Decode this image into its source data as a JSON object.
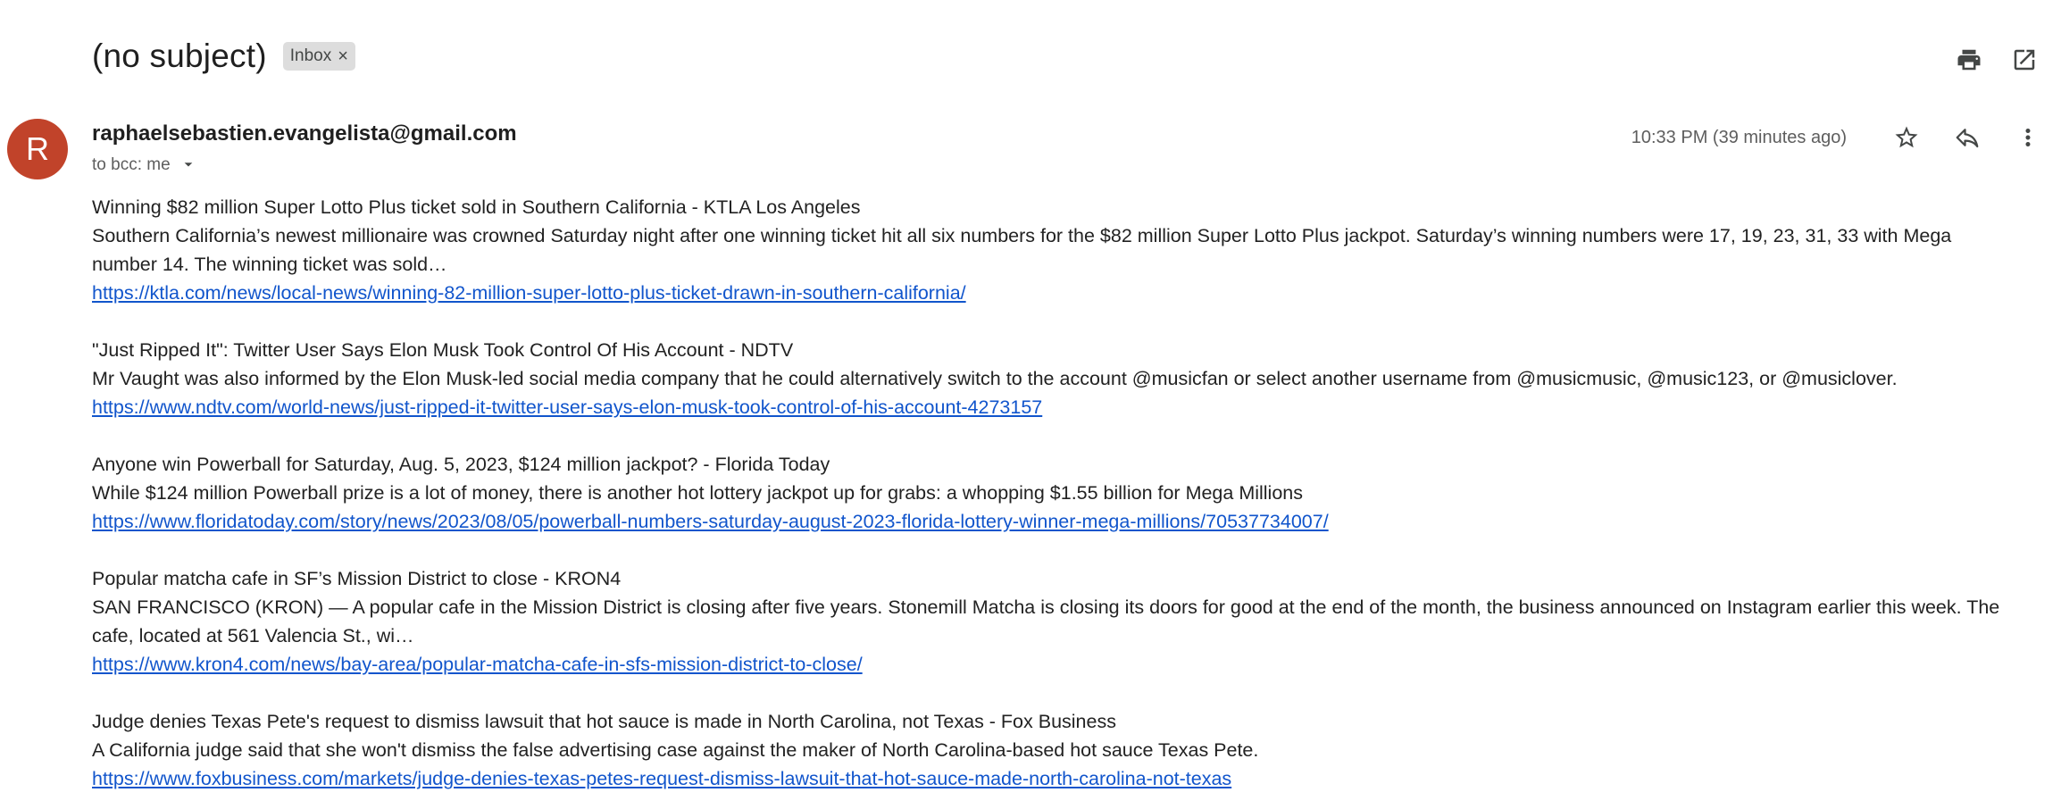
{
  "header": {
    "subject": "(no subject)",
    "label": "Inbox",
    "label_remove": "×"
  },
  "sender": {
    "avatar_letter": "R",
    "email": "raphaelsebastien.evangelista@gmail.com",
    "recipients": "to bcc: me",
    "timestamp": "10:33 PM (39 minutes ago)"
  },
  "colors": {
    "avatar": "#c1432a",
    "link": "#1155cc",
    "chip": "#dddddd"
  },
  "icons": {
    "print": "print-icon",
    "open_new_window": "open-in-new-window-icon",
    "star": "star-icon",
    "reply": "reply-icon",
    "more": "more-vert-icon",
    "dropdown": "dropdown-arrow-icon"
  },
  "items": [
    {
      "title": "Winning $82 million Super Lotto Plus ticket sold in Southern California - KTLA Los Angeles",
      "snippet": "Southern California’s newest millionaire was crowned Saturday night after one winning ticket hit all six numbers for the $82 million Super Lotto Plus jackpot. Saturday’s winning numbers were 17, 19, 23, 31, 33 with Mega number 14.  The winning ticket was sold…",
      "url": "https://ktla.com/news/local-news/winning-82-million-super-lotto-plus-ticket-drawn-in-southern-california/"
    },
    {
      "title": "\"Just Ripped It\": Twitter User Says Elon Musk Took Control Of His Account - NDTV",
      "snippet": "Mr Vaught was also informed by the Elon Musk-led social media company that he could alternatively switch to the account @musicfan or select another username from @musicmusic, @music123, or @musiclover.",
      "url": "https://www.ndtv.com/world-news/just-ripped-it-twitter-user-says-elon-musk-took-control-of-his-account-4273157"
    },
    {
      "title": "Anyone win Powerball for Saturday, Aug. 5, 2023, $124 million jackpot? - Florida Today",
      "snippet": "While $124 million Powerball prize is a lot of money, there is another hot lottery jackpot up for grabs: a whopping $1.55 billion for Mega Millions",
      "url": "https://www.floridatoday.com/story/news/2023/08/05/powerball-numbers-saturday-august-2023-florida-lottery-winner-mega-millions/70537734007/"
    },
    {
      "title": "Popular matcha cafe in SF’s Mission District to close - KRON4",
      "snippet": "SAN FRANCISCO (KRON) — A popular cafe in the Mission District is closing after five years. Stonemill Matcha is closing its doors for good at the end of the month, the business announced on Instagram earlier this week. The cafe, located at 561 Valencia St., wi…",
      "url": "https://www.kron4.com/news/bay-area/popular-matcha-cafe-in-sfs-mission-district-to-close/"
    },
    {
      "title": "Judge denies Texas Pete's request to dismiss lawsuit that hot sauce is made in North Carolina, not Texas - Fox Business",
      "snippet": "A California judge said that she won't dismiss the false advertising case against the maker of North Carolina-based hot sauce Texas Pete.",
      "url": "https://www.foxbusiness.com/markets/judge-denies-texas-petes-request-dismiss-lawsuit-that-hot-sauce-made-north-carolina-not-texas"
    }
  ]
}
